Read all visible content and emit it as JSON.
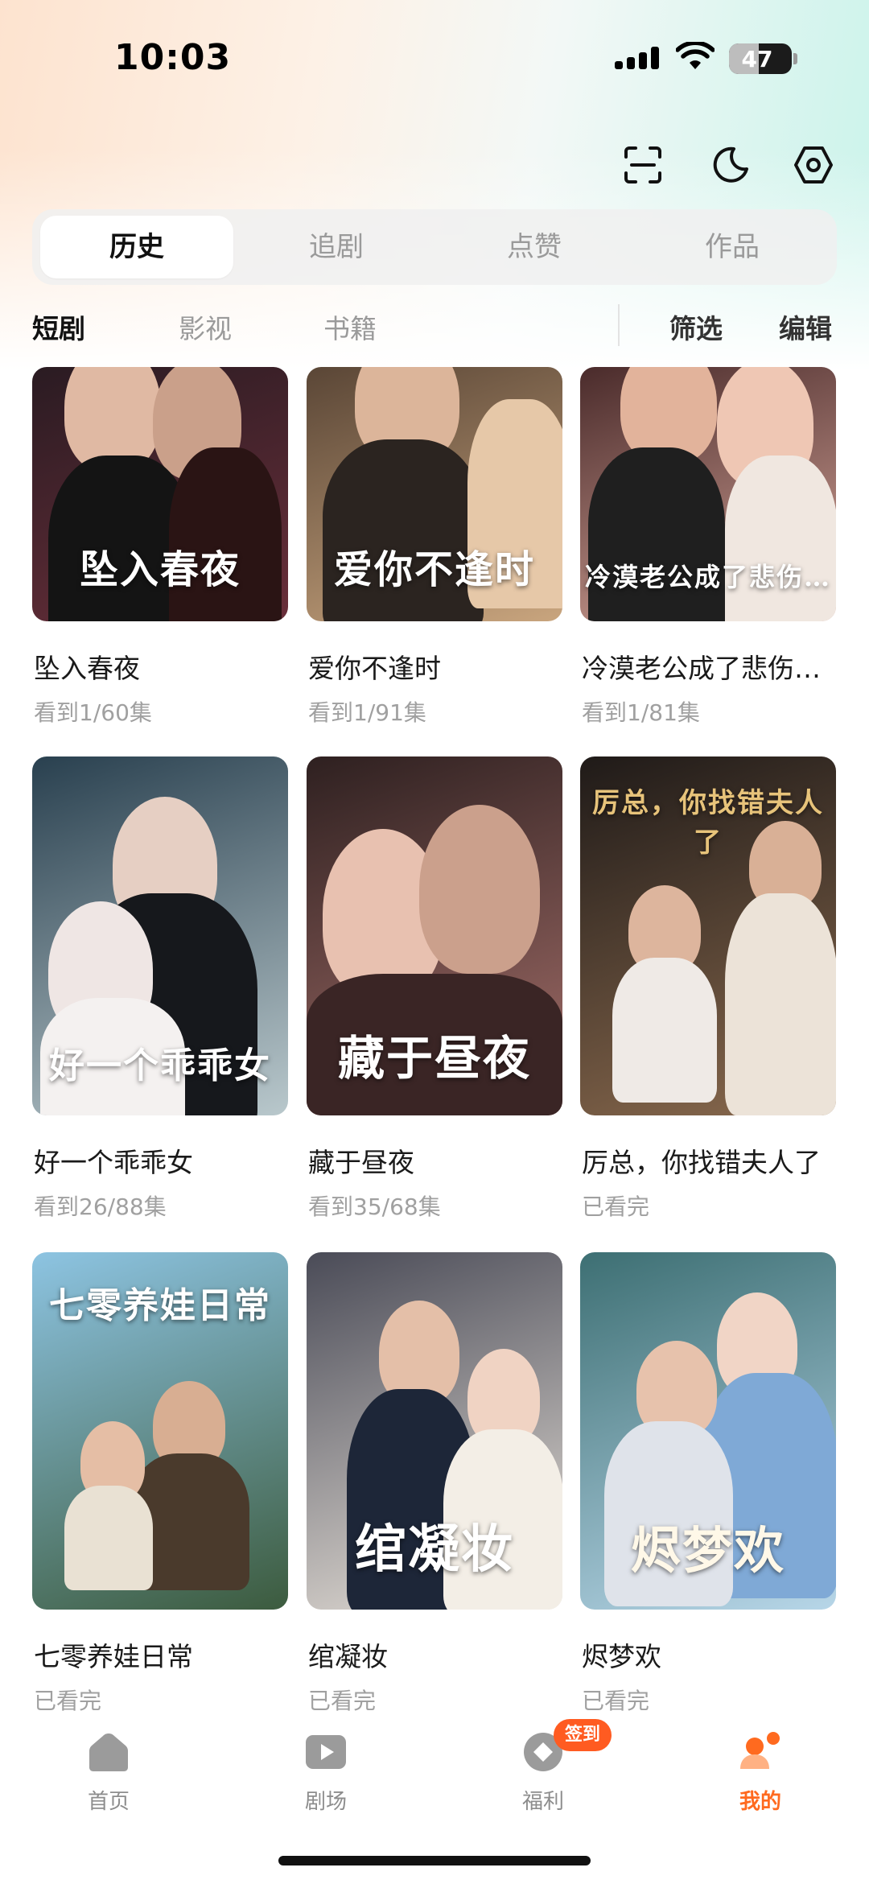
{
  "status_bar": {
    "time": "10:03",
    "battery": "47",
    "battery_level": 0.47
  },
  "header": {
    "icons": [
      "scan-icon",
      "moon-icon",
      "settings-icon"
    ]
  },
  "tabs": [
    {
      "label": "历史",
      "active": true
    },
    {
      "label": "追剧",
      "active": false
    },
    {
      "label": "点赞",
      "active": false
    },
    {
      "label": "作品",
      "active": false
    }
  ],
  "subtabs": [
    {
      "label": "短剧",
      "active": true
    },
    {
      "label": "影视",
      "active": false
    },
    {
      "label": "书籍",
      "active": false
    }
  ],
  "actions": {
    "filter": "筛选",
    "edit": "编辑"
  },
  "items": [
    {
      "title": "坠入春夜",
      "progress": "看到1/60集",
      "colors": [
        "#2a1b22",
        "#6a2f3a"
      ]
    },
    {
      "title": "爱你不逢时",
      "progress": "看到1/91集",
      "colors": [
        "#5a4636",
        "#c9a57e"
      ]
    },
    {
      "title": "冷漠老公成了悲伤…",
      "progress": "看到1/81集",
      "colors": [
        "#4a2b2b",
        "#d7a69a"
      ]
    },
    {
      "title": "好一个乖乖女",
      "progress": "看到26/88集",
      "colors": [
        "#29404f",
        "#b9c8cc"
      ]
    },
    {
      "title": "藏于昼夜",
      "progress": "看到35/68集",
      "colors": [
        "#2e2020",
        "#a56f6a"
      ]
    },
    {
      "title": "厉总，你找错夫人了",
      "progress": "已看完",
      "colors": [
        "#1f1a18",
        "#8a6a4e"
      ]
    },
    {
      "title": "七零养娃日常",
      "progress": "已看完",
      "colors": [
        "#8dc4e2",
        "#3c5b3e"
      ]
    },
    {
      "title": "绾凝妆",
      "progress": "已看完",
      "colors": [
        "#4a4b57",
        "#e8e2da"
      ]
    },
    {
      "title": "烬梦欢",
      "progress": "已看完",
      "colors": [
        "#3d6f73",
        "#b7d6e8"
      ]
    }
  ],
  "nav": [
    {
      "label": "首页",
      "active": false
    },
    {
      "label": "剧场",
      "active": false
    },
    {
      "label": "福利",
      "active": false
    },
    {
      "label": "我的",
      "active": true
    }
  ],
  "nav_badge": "签到",
  "colors": {
    "accent": "#ff6a1f",
    "badge": "#ff5b21"
  }
}
